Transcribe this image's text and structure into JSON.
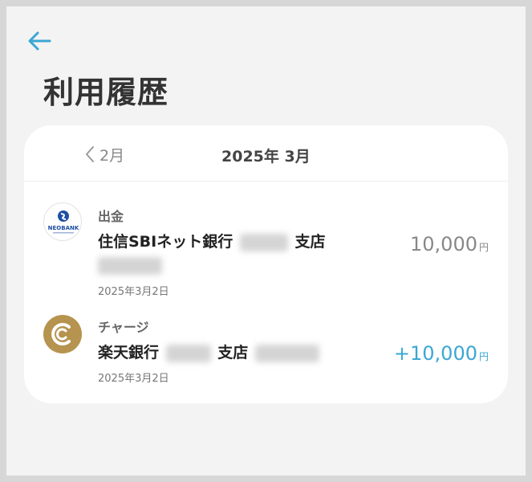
{
  "header": {
    "title": "利用履歴"
  },
  "month_nav": {
    "prev_label": "2月",
    "current_label": "2025年 3月"
  },
  "transactions": [
    {
      "type": "出金",
      "name": "住信SBIネット銀行",
      "branch_suffix": "支店",
      "date": "2025年3月2日",
      "amount": "10,000",
      "currency": "円",
      "logo_text": "NEOBANK"
    },
    {
      "type": "チャージ",
      "name": "楽天銀行",
      "branch_suffix": "支店",
      "date": "2025年3月2日",
      "amount": "+10,000",
      "currency": "円"
    }
  ],
  "colors": {
    "accent": "#3ba7d3",
    "coin_gold": "#b6934e",
    "neobank_blue": "#1e4fa3"
  },
  "icons": [
    "back-arrow-icon",
    "chevron-left-icon",
    "neobank-logo-icon",
    "coin-logo-icon"
  ]
}
